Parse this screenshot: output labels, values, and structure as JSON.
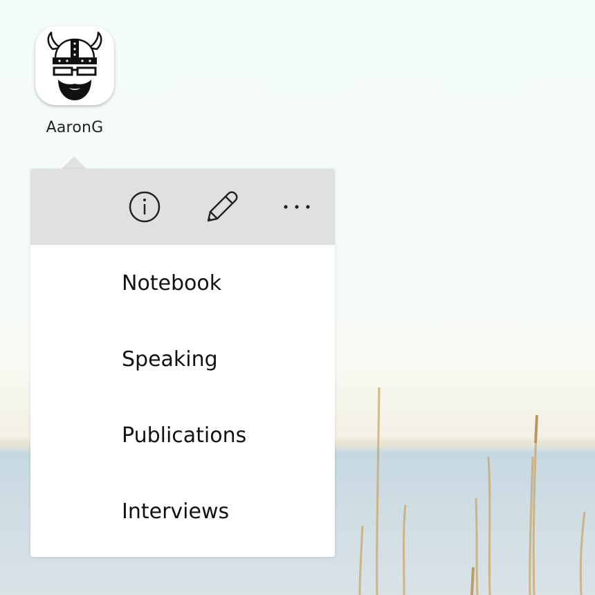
{
  "app": {
    "label": "AaronG",
    "icon": "viking-avatar-icon"
  },
  "popup": {
    "toolbar": {
      "buttons": [
        {
          "icon": "info-icon"
        },
        {
          "icon": "pencil-icon"
        },
        {
          "icon": "more-horizontal-icon"
        }
      ]
    },
    "items": [
      {
        "label": "Notebook"
      },
      {
        "label": "Speaking"
      },
      {
        "label": "Publications"
      },
      {
        "label": "Interviews"
      }
    ]
  },
  "colors": {
    "toolbar_bg": "#e0e0e0",
    "menu_bg": "#ffffff",
    "text": "#111111"
  }
}
